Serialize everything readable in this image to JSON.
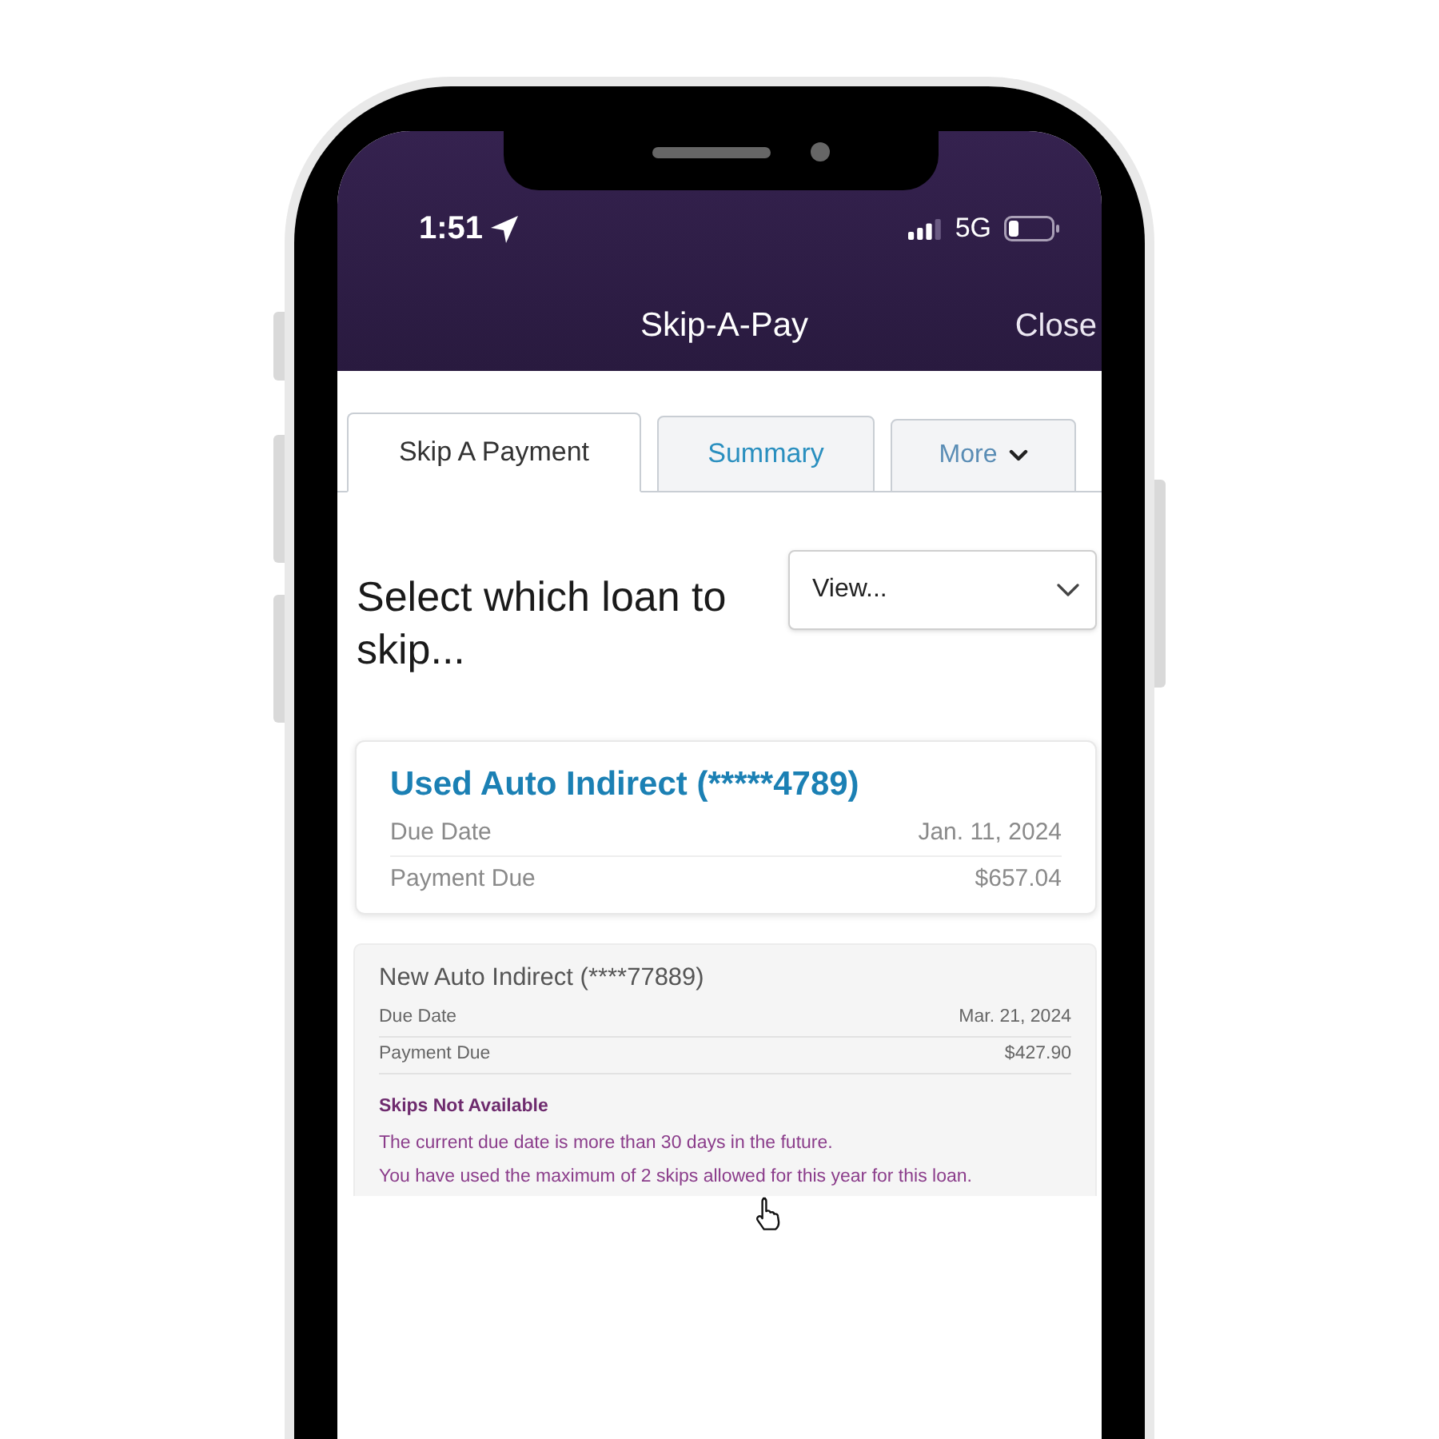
{
  "status_bar": {
    "time": "1:51",
    "network": "5G"
  },
  "header": {
    "title": "Skip-A-Pay",
    "close": "Close"
  },
  "tabs": [
    {
      "kind": "tab",
      "label": "Skip A Payment",
      "selected": true
    },
    {
      "kind": "tab",
      "label": "Summary",
      "selected": false
    },
    {
      "kind": "menu",
      "label": "More",
      "selected": false
    }
  ],
  "loan_picker": {
    "heading": "Select which loan to skip...",
    "select_value": "View..."
  },
  "loans": [
    {
      "kind": "available",
      "title": "Used Auto Indirect (*****4789)",
      "rows": [
        {
          "label": "Due Date",
          "value": "Jan. 11, 2024"
        },
        {
          "label": "Payment Due",
          "value": "$657.04"
        }
      ]
    },
    {
      "kind": "unavailable",
      "title": "New Auto Indirect (****77889)",
      "rows": [
        {
          "label": "Due Date",
          "value": "Mar. 21, 2024"
        },
        {
          "label": "Payment Due",
          "value": "$427.90"
        }
      ],
      "notice": {
        "title": "Skips Not Available",
        "messages": [
          "The current due date is more than 30 days in the future.",
          "You have used the maximum of 2 skips allowed for this year for this loan."
        ]
      }
    }
  ]
}
